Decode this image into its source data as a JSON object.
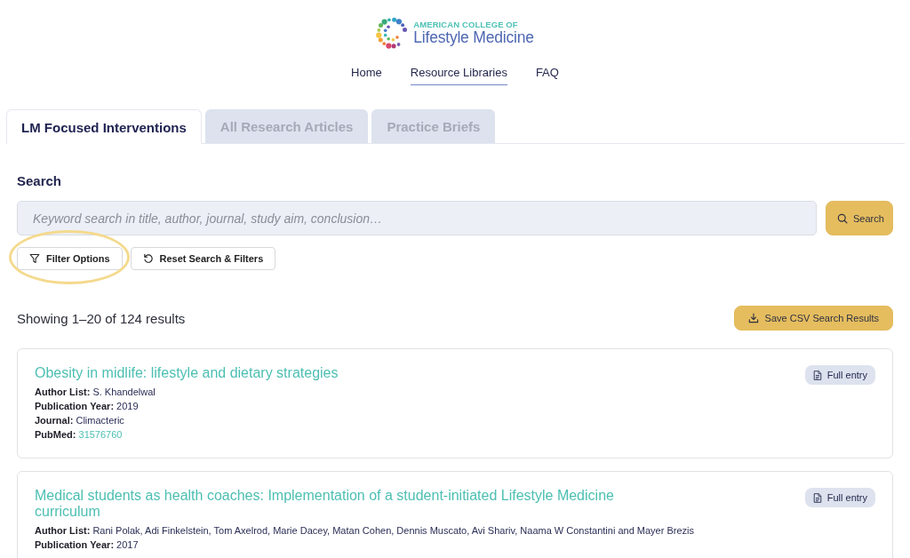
{
  "logo": {
    "line_1": "AMERICAN COLLEGE OF",
    "line_2": "Lifestyle Medicine"
  },
  "nav": [
    {
      "label": "Home",
      "selected": false
    },
    {
      "label": "Resource Libraries",
      "selected": true
    },
    {
      "label": "FAQ",
      "selected": false
    }
  ],
  "tabs": [
    {
      "label": "LM Focused Interventions",
      "selected": true
    },
    {
      "label": "All Research Articles",
      "selected": false
    },
    {
      "label": "Practice Briefs",
      "selected": false
    }
  ],
  "search": {
    "label": "Search",
    "placeholder": "Keyword search in title, author, journal, study aim, conclusion…",
    "button": "Search"
  },
  "actions": [
    {
      "kind": "filter",
      "label": "Filter Options",
      "highlighted": true
    },
    {
      "kind": "reset",
      "label": "Reset Search & Filters",
      "highlighted": false
    }
  ],
  "results": {
    "summary": "Showing 1–20 of 124 results",
    "export_button": "Save CSV Search Results"
  },
  "entries": [
    {
      "title": "Obesity in midlife: lifestyle and dietary strategies",
      "button": "Full entry",
      "fields": [
        {
          "kind": "text",
          "text": "**Author List:** S. Khandelwal"
        },
        {
          "kind": "text",
          "text": "**Publication Year:** 2019"
        },
        {
          "kind": "text",
          "text": "**Journal:** Climacteric"
        },
        {
          "kind": "link",
          "label": "PubMed:",
          "link": "31576760"
        }
      ]
    },
    {
      "title": "Medical students as health coaches: Implementation of a student-initiated Lifestyle Medicine curriculum",
      "button": "Full entry",
      "fields": [
        {
          "kind": "text",
          "text": "**Author List:** Rani Polak, Adi Finkelstein, Tom Axelrod, Marie Dacey, Matan Cohen, Dennis Muscato, Avi Shariv, Naama W Constantini and Mayer Brezis"
        },
        {
          "kind": "text",
          "text": "**Publication Year:** 2017"
        }
      ]
    }
  ]
}
